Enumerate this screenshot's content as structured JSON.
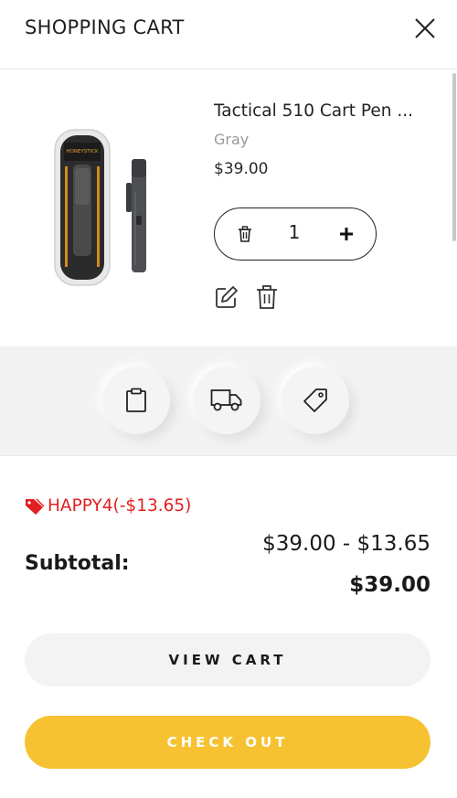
{
  "header": {
    "title": "SHOPPING CART"
  },
  "item": {
    "name": "Tactical 510 Cart Pen ...",
    "variant": "Gray",
    "price": "$39.00",
    "quantity": "1",
    "package_brand": "HONEYSTICK"
  },
  "coupon": {
    "label": "HAPPY4(-$13.65)",
    "color": "#e02020"
  },
  "summary": {
    "subtotal_label": "Subtotal:",
    "calculation": "$39.00 - $13.65",
    "total": "$39.00"
  },
  "actions": {
    "view_cart_label": "VIEW CART",
    "checkout_label": "CHECK OUT"
  },
  "icons": [
    "close-icon",
    "trash-icon",
    "plus-icon",
    "edit-icon",
    "clipboard-icon",
    "truck-icon",
    "tag-icon"
  ],
  "colors": {
    "accent": "#f7c231",
    "coupon": "#e02020",
    "tools_bg": "#f2f2f2"
  }
}
